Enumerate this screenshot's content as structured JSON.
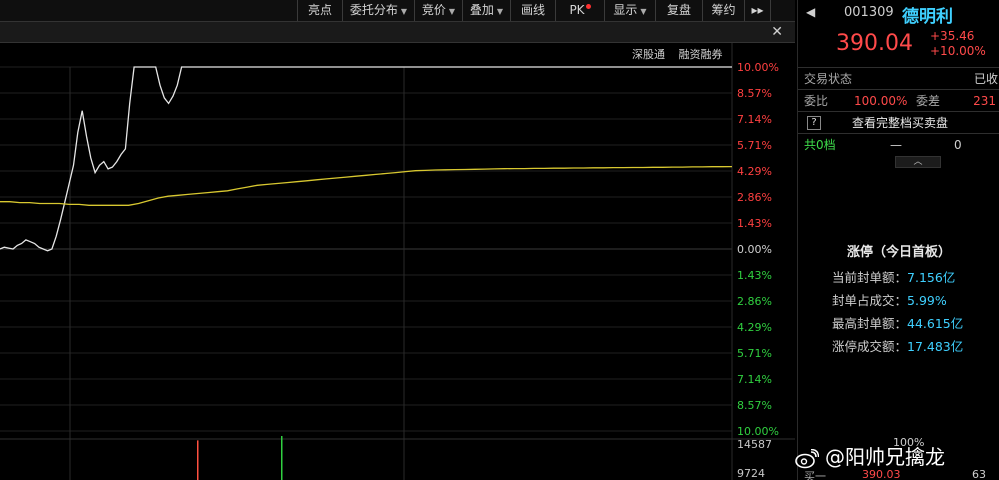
{
  "toolbar": {
    "items": [
      {
        "label": "亮点",
        "caret": false
      },
      {
        "label": "委托分布",
        "caret": true
      },
      {
        "label": "竞价",
        "caret": true
      },
      {
        "label": "叠加",
        "caret": true
      },
      {
        "label": "画线",
        "caret": false
      },
      {
        "label": "PK",
        "caret": false,
        "dot": true
      },
      {
        "label": "显示",
        "caret": true
      },
      {
        "label": "复盘",
        "caret": false
      },
      {
        "label": "筹约",
        "caret": false
      },
      {
        "label": "▸▸",
        "caret": false
      }
    ]
  },
  "second_bar": {
    "close": "✕"
  },
  "chart_tags": [
    "深股通",
    "融资融券"
  ],
  "right_axis": {
    "labels": [
      "10.00%",
      "8.57%",
      "7.14%",
      "5.71%",
      "4.29%",
      "2.86%",
      "1.43%",
      "0.00%",
      "1.43%",
      "2.86%",
      "4.29%",
      "5.71%",
      "7.14%",
      "8.57%",
      "10.00%"
    ],
    "colors": {
      "up": "#ff4040",
      "zero": "#d0d0d0",
      "down": "#30d040"
    }
  },
  "volume_axis": {
    "labels": [
      "14587",
      "9724"
    ]
  },
  "chart_data": {
    "type": "line",
    "y_unit": "%",
    "ylim": [
      -10,
      10
    ],
    "series": [
      {
        "color": "#e6e6e6",
        "values": [
          0.0,
          0.1,
          0.05,
          0.0,
          0.2,
          0.3,
          0.5,
          0.4,
          0.3,
          0.1,
          0.0,
          -0.1,
          0.0,
          0.7,
          1.6,
          2.6,
          3.6,
          4.6,
          6.4,
          7.6,
          6.2,
          5.0,
          4.2,
          4.6,
          4.8,
          4.4,
          4.5,
          4.8,
          5.2,
          5.5,
          8.0,
          10.0,
          10.0,
          10.0,
          10.0,
          10.0,
          10.0,
          9.0,
          8.3,
          8.0,
          8.4,
          9.0,
          10.0,
          10.0,
          10.0,
          10.0,
          10.0,
          10.0,
          10.0,
          10.0,
          10.0,
          10.0,
          10.0,
          10.0,
          10.0,
          10.0,
          10.0,
          10.0,
          10.0,
          10.0,
          10.0,
          10.0,
          10.0,
          10.0,
          10.0,
          10.0,
          10.0,
          10.0,
          10.0,
          10.0,
          10.0,
          10.0,
          10.0,
          10.0,
          10.0
        ]
      },
      {
        "color": "#d8c830",
        "values": [
          2.6,
          2.6,
          2.55,
          2.55,
          2.5,
          2.5,
          2.5,
          2.45,
          2.45,
          2.4,
          2.4,
          2.4,
          2.4,
          2.4,
          2.5,
          2.65,
          2.8,
          2.9,
          2.95,
          3.0,
          3.05,
          3.1,
          3.15,
          3.2,
          3.3,
          3.4,
          3.5,
          3.55,
          3.6,
          3.65,
          3.7,
          3.75,
          3.8,
          3.85,
          3.9,
          3.95,
          4.0,
          4.05,
          4.1,
          4.15,
          4.2,
          4.25,
          4.3,
          4.32,
          4.34,
          4.35,
          4.36,
          4.37,
          4.38,
          4.39,
          4.4,
          4.41,
          4.42,
          4.42,
          4.43,
          4.43,
          4.44,
          4.44,
          4.45,
          4.45,
          4.46,
          4.46,
          4.47,
          4.47,
          4.48,
          4.48,
          4.49,
          4.49,
          4.5,
          4.5,
          4.51,
          4.51,
          4.52,
          4.52,
          4.53
        ]
      }
    ],
    "volume_bars": [
      {
        "color": "#ff5040",
        "value": 0.9
      },
      {
        "color": "#30d040",
        "value": 1.0
      }
    ]
  },
  "stock": {
    "code": "001309",
    "name": "德明利",
    "price": "390.04",
    "change": "+35.46",
    "change_pct": "+10.00%"
  },
  "panel": {
    "status_label": "交易状态",
    "status_value": "已收",
    "wb_label": "委比",
    "wb_value": "100.00%",
    "wc_label": "委差",
    "wc_value": "231",
    "q_icon": "?",
    "full_book": "查看完整档买卖盘",
    "total_label": "共0档",
    "total_dash": "—",
    "total_zero": "0",
    "expand": "︿"
  },
  "limit_up": {
    "title": "涨停（今日首板）",
    "rows": [
      {
        "k": "当前封单额：",
        "v": "7.156亿"
      },
      {
        "k": "封单占成交：",
        "v": "5.99%"
      },
      {
        "k": "最高封单额：",
        "v": "44.615亿"
      },
      {
        "k": "涨停成交额：",
        "v": "17.483亿"
      }
    ]
  },
  "bottom": {
    "pct": "100%",
    "a": "买一",
    "b": "390.03",
    "c": "63"
  },
  "watermark": "@阳帅兄擒龙"
}
